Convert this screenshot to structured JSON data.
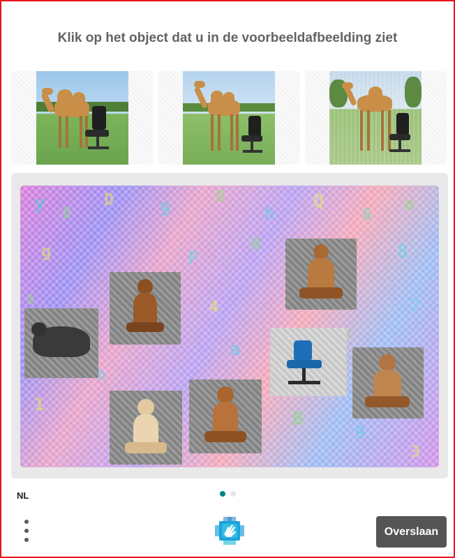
{
  "challenge": {
    "prompt": "Klik op het object dat u in de voorbeeldafbeelding ziet",
    "examples": [
      {
        "label": "camel-with-office-chair-1"
      },
      {
        "label": "camel-with-office-chair-2"
      },
      {
        "label": "camel-with-office-chair-3"
      }
    ],
    "tiles": [
      {
        "name": "tile-cat-sleeping"
      },
      {
        "name": "tile-chess-pawn-dark-1"
      },
      {
        "name": "tile-chess-pawn-dark-2"
      },
      {
        "name": "tile-office-chair"
      },
      {
        "name": "tile-chess-pawn-dark-3"
      },
      {
        "name": "tile-chess-pawn-light"
      },
      {
        "name": "tile-chess-pawn-dark-4"
      }
    ]
  },
  "footer": {
    "language": "NL",
    "page_indicator": {
      "current": 1,
      "total": 2
    },
    "skip_label": "Overslaan",
    "menu_icon": "more-vertical-icon",
    "logo_icon": "hcaptcha-hand-logo"
  },
  "colors": {
    "border": "#e8141e",
    "button_bg": "#555555",
    "dot_active": "#00838f",
    "dot_inactive": "#e6e6e6",
    "title": "#636363"
  }
}
